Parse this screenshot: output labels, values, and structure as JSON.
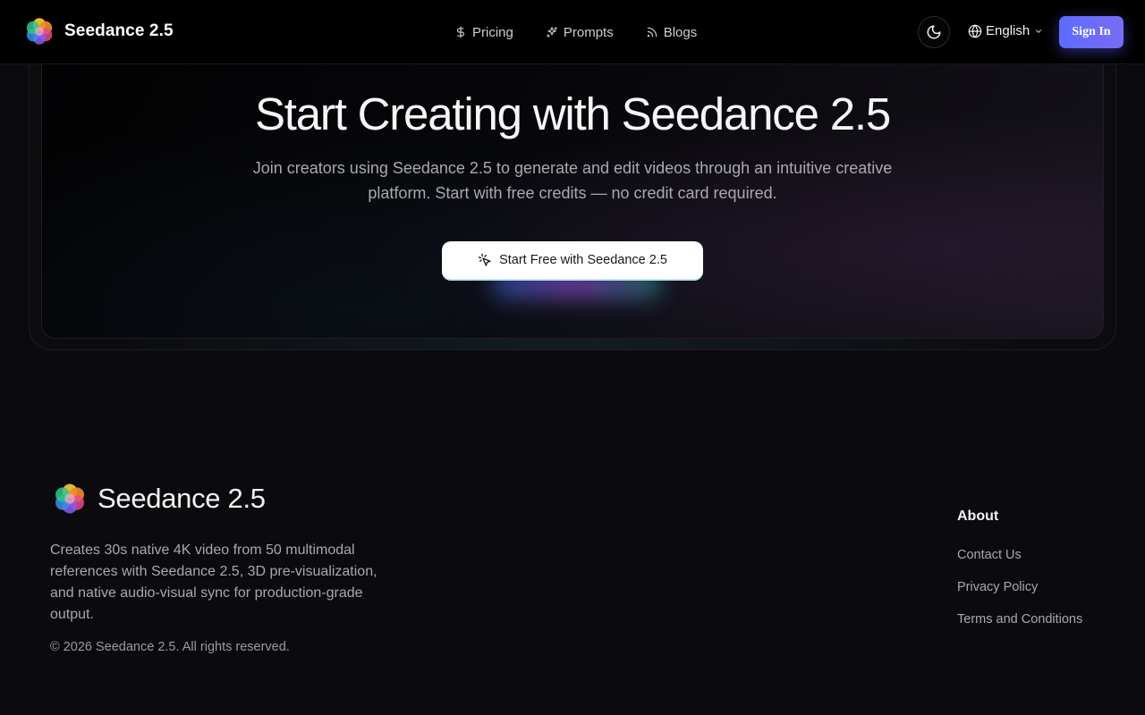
{
  "nav": {
    "brand": "Seedance 2.5",
    "items": [
      {
        "label": "Pricing",
        "icon": "dollar-icon"
      },
      {
        "label": "Prompts",
        "icon": "sparkles-icon"
      },
      {
        "label": "Blogs",
        "icon": "rss-icon"
      }
    ],
    "theme_icon": "moon-icon",
    "language": "English",
    "signin_label": "Sign In"
  },
  "cta": {
    "title": "Start Creating with Seedance 2.5",
    "subtitle": "Join creators using Seedance 2.5 to generate and edit videos through an intuitive creative platform. Start with free credits — no credit card required.",
    "button_label": "Start Free with Seedance 2.5",
    "button_icon": "cursor-click-icon"
  },
  "footer": {
    "brand": "Seedance 2.5",
    "description": "Creates 30s native 4K video from 50 multimodal references with Seedance 2.5, 3D pre-visualization, and native audio-visual sync for production-grade output.",
    "copyright": "© 2026 Seedance 2.5. All rights reserved.",
    "about": {
      "heading": "About",
      "links": [
        "Contact Us",
        "Privacy Policy",
        "Terms and Conditions"
      ]
    }
  },
  "colors": {
    "background": "#0b0b0d",
    "nav_background": "#000000",
    "signin_gradient_start": "#5b6cff",
    "signin_gradient_end": "#7a6cf5",
    "muted_text": "#a8a8ae"
  }
}
